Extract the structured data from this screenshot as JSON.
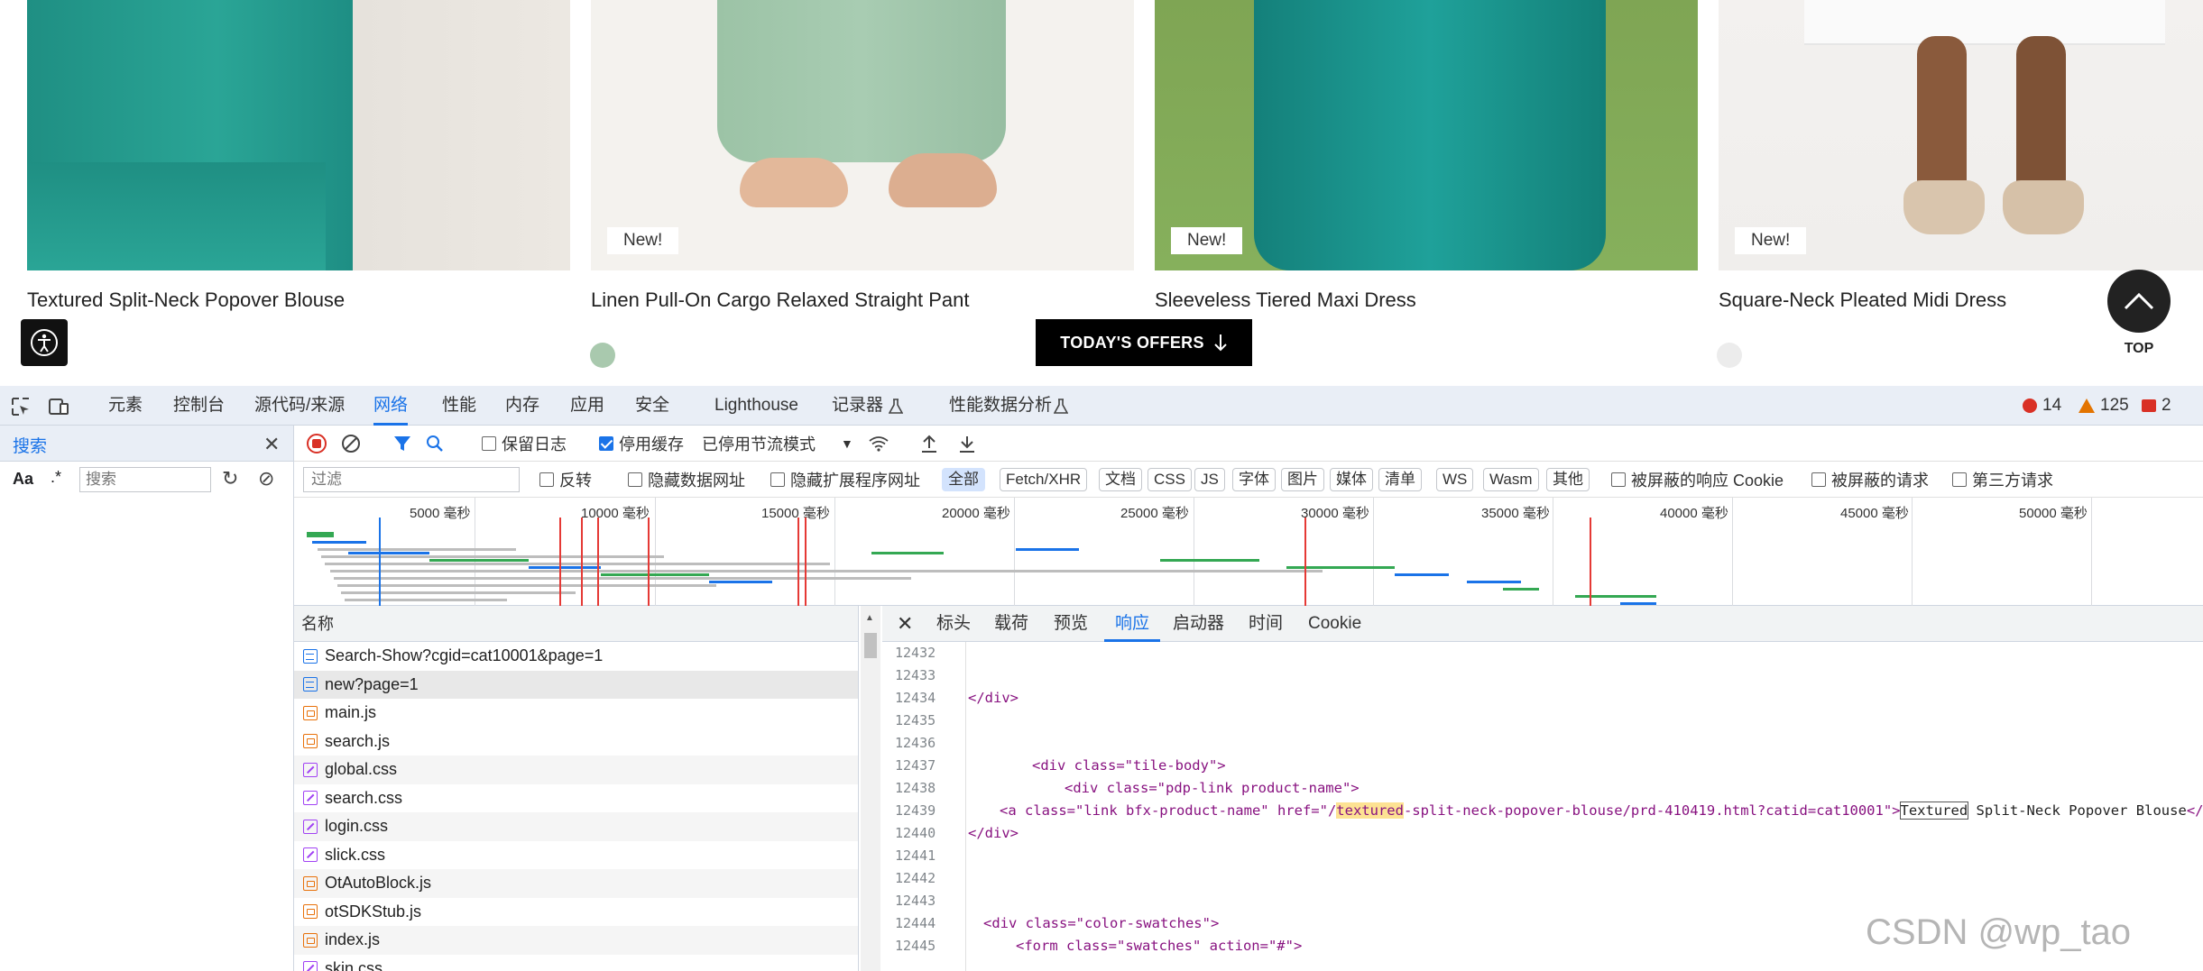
{
  "products": [
    {
      "title": "Textured Split-Neck Popover Blouse",
      "badge": ""
    },
    {
      "title": "Linen Pull-On Cargo Relaxed Straight Pant",
      "badge": "New!"
    },
    {
      "title": "Sleeveless Tiered Maxi Dress",
      "badge": "New!"
    },
    {
      "title": "Square-Neck Pleated Midi Dress",
      "badge": "New!"
    }
  ],
  "offers_button": "TODAY'S OFFERS",
  "top_label": "TOP",
  "devtools": {
    "tabs": [
      "元素",
      "控制台",
      "源代码/来源",
      "网络",
      "性能",
      "内存",
      "应用",
      "安全",
      "Lighthouse",
      "记录器",
      "性能数据分析"
    ],
    "active_tab": "网络",
    "errors": "14",
    "warnings": "125",
    "issues": "2",
    "search": {
      "title": "搜索",
      "aa": "Aa",
      "regex": ".*",
      "placeholder": "搜索"
    },
    "toolbar1": {
      "preserve_log": "保留日志",
      "disable_cache": "停用缓存",
      "throttle": "已停用节流模式"
    },
    "toolbar2": {
      "filter_placeholder": "过滤",
      "invert": "反转",
      "hide_data_urls": "隐藏数据网址",
      "hide_ext_urls": "隐藏扩展程序网址",
      "types": [
        "全部",
        "Fetch/XHR",
        "文档",
        "CSS",
        "JS",
        "字体",
        "图片",
        "媒体",
        "清单",
        "WS",
        "Wasm",
        "其他"
      ],
      "blocked_cookies": "被屏蔽的响应 Cookie",
      "blocked_requests": "被屏蔽的请求",
      "third_party": "第三方请求"
    },
    "timeline_ticks": [
      "5000 毫秒",
      "10000 毫秒",
      "15000 毫秒",
      "20000 毫秒",
      "25000 毫秒",
      "30000 毫秒",
      "35000 毫秒",
      "40000 毫秒",
      "45000 毫秒",
      "50000 毫秒"
    ],
    "name_header": "名称",
    "requests": [
      {
        "name": "Search-Show?cgid=cat10001&page=1",
        "type": "doc"
      },
      {
        "name": "new?page=1",
        "type": "doc"
      },
      {
        "name": "main.js",
        "type": "js"
      },
      {
        "name": "search.js",
        "type": "js"
      },
      {
        "name": "global.css",
        "type": "css"
      },
      {
        "name": "search.css",
        "type": "css"
      },
      {
        "name": "login.css",
        "type": "css"
      },
      {
        "name": "slick.css",
        "type": "css"
      },
      {
        "name": "OtAutoBlock.js",
        "type": "js"
      },
      {
        "name": "otSDKStub.js",
        "type": "js"
      },
      {
        "name": "index.js",
        "type": "js"
      },
      {
        "name": "skin.css",
        "type": "css"
      }
    ],
    "detail_tabs": [
      "标头",
      "载荷",
      "预览",
      "响应",
      "启动器",
      "时间",
      "Cookie"
    ],
    "active_detail_tab": "响应",
    "code_lines": [
      {
        "n": "12432",
        "t": ""
      },
      {
        "n": "12433",
        "t": ""
      },
      {
        "n": "12434",
        "t": "</div>"
      },
      {
        "n": "12435",
        "t": ""
      },
      {
        "n": "12436",
        "t": ""
      },
      {
        "n": "12437",
        "t": "<div class=\"tile-body\">"
      },
      {
        "n": "12438",
        "t": "<div class=\"pdp-link product-name\">"
      },
      {
        "n": "12439",
        "t": "<a class=\"link bfx-product-name\" href=\"/textured-split-neck-popover-blouse/prd-410419.html?catid=cat10001\">Textured Split-Neck Popover Blouse</a>"
      },
      {
        "n": "12440",
        "t": "</div>"
      },
      {
        "n": "12441",
        "t": ""
      },
      {
        "n": "12442",
        "t": ""
      },
      {
        "n": "12443",
        "t": ""
      },
      {
        "n": "12444",
        "t": "<div class=\"color-swatches\">"
      },
      {
        "n": "12445",
        "t": "<form class=\"swatches\" action=\"#\">"
      }
    ]
  },
  "watermark": "CSDN @wp_tao"
}
